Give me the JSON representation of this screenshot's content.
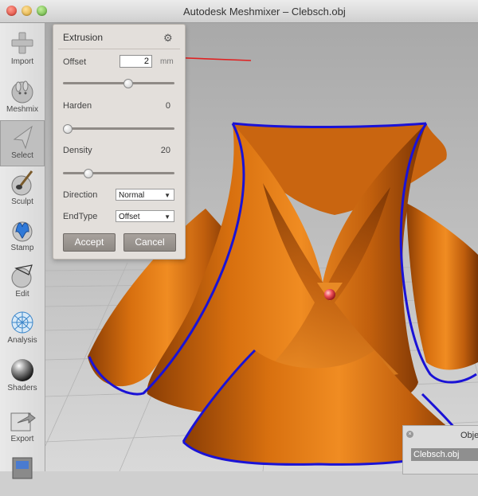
{
  "window": {
    "title": "Autodesk Meshmixer – Clebsch.obj"
  },
  "toolbar": {
    "items": [
      {
        "label": "Import"
      },
      {
        "label": "Meshmix"
      },
      {
        "label": "Select"
      },
      {
        "label": "Sculpt"
      },
      {
        "label": "Stamp"
      },
      {
        "label": "Edit"
      },
      {
        "label": "Analysis"
      },
      {
        "label": "Shaders"
      },
      {
        "label": "Export"
      }
    ]
  },
  "extrusion_panel": {
    "title": "Extrusion",
    "offset_label": "Offset",
    "offset_value": "2",
    "offset_unit": "mm",
    "offset_slider": 0.58,
    "harden_label": "Harden",
    "harden_value": "0",
    "harden_slider": 0.0,
    "density_label": "Density",
    "density_value": "20",
    "density_slider": 0.2,
    "direction_label": "Direction",
    "direction_value": "Normal",
    "endtype_label": "EndType",
    "endtype_value": "Offset",
    "accept_label": "Accept",
    "cancel_label": "Cancel"
  },
  "objects_panel": {
    "title": "Obje",
    "item": "Clebsch.obj"
  },
  "colors": {
    "mesh": "#e07411",
    "boundary": "#1a12d6",
    "annotation_arrow": "#e02020"
  }
}
